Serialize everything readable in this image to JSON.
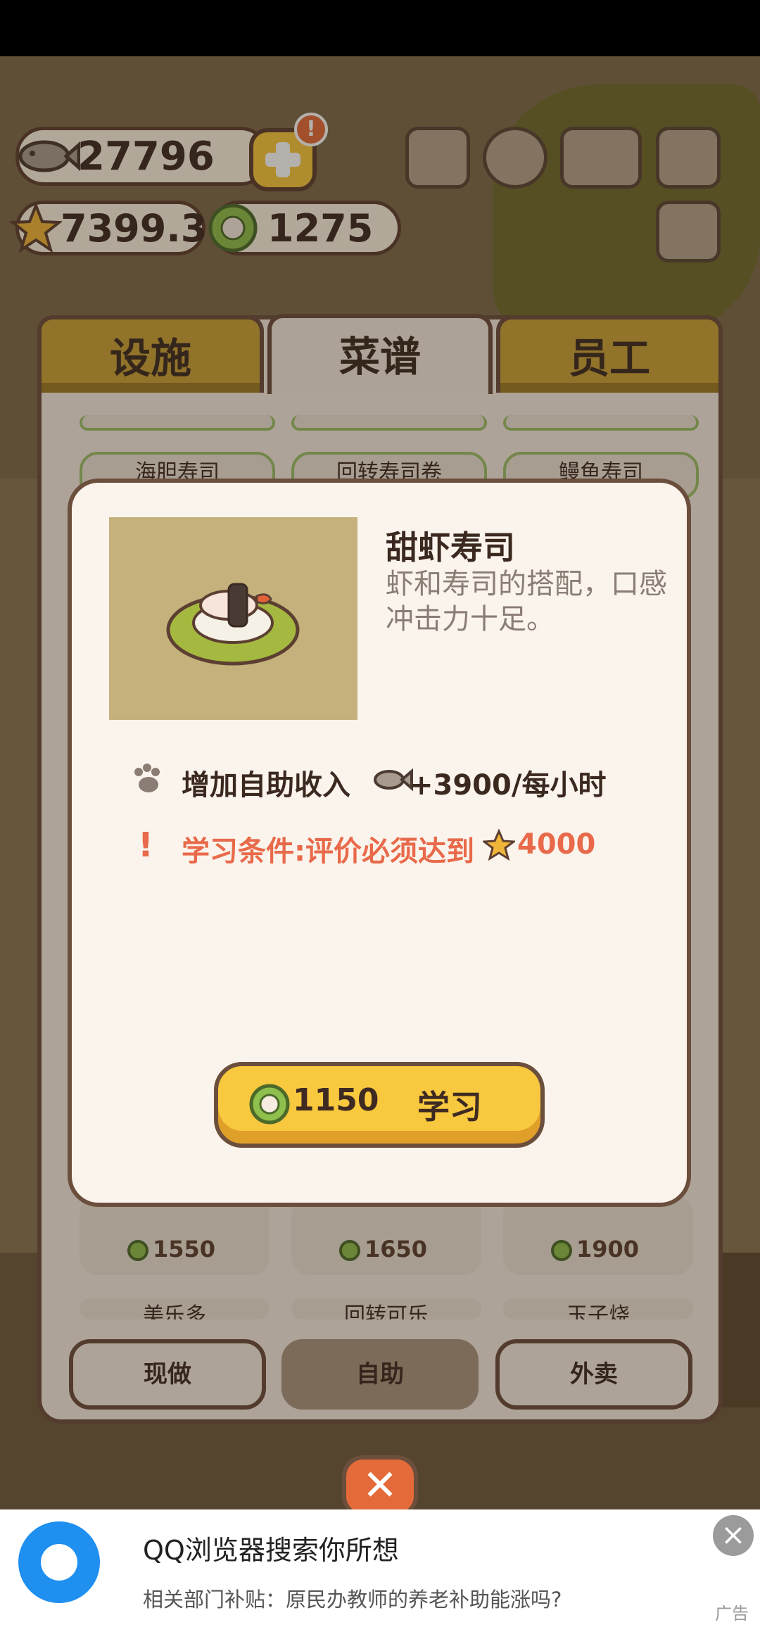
{
  "currency": {
    "fish": "27796",
    "rating": "7399.3",
    "coins": "1275"
  },
  "tabs": [
    "设施",
    "菜谱",
    "员工"
  ],
  "background_cards": {
    "top_row": [
      "海胆寿司",
      "回转寿司卷",
      "鳗鱼寿司"
    ],
    "prices": [
      "1550",
      "1650",
      "1900"
    ],
    "next_row": [
      "美乐多",
      "回转可乐",
      "玉子烧"
    ]
  },
  "bottom_tabs": [
    "现做",
    "自助",
    "外卖"
  ],
  "dialog": {
    "name": "甜虾寿司",
    "description": "虾和寿司的搭配，口感冲击力十足。",
    "bonus_prefix": "增加自助收入",
    "bonus_value": "+3900/每小时",
    "requirement_prefix": "学习条件:评价必须达到",
    "requirement_value": "4000",
    "learn_cost": "1150",
    "learn_label": "学习"
  },
  "ad": {
    "title": "QQ浏览器搜索你所想",
    "subtitle": "相关部门补贴：原民办教师的养老补助能涨吗?",
    "tag": "广告"
  },
  "colors": {
    "tab_gold": "#c9a238",
    "button_yellow": "#f8c83e",
    "requirement_red": "#e86a4a",
    "border_brown": "#6b4e3c"
  }
}
